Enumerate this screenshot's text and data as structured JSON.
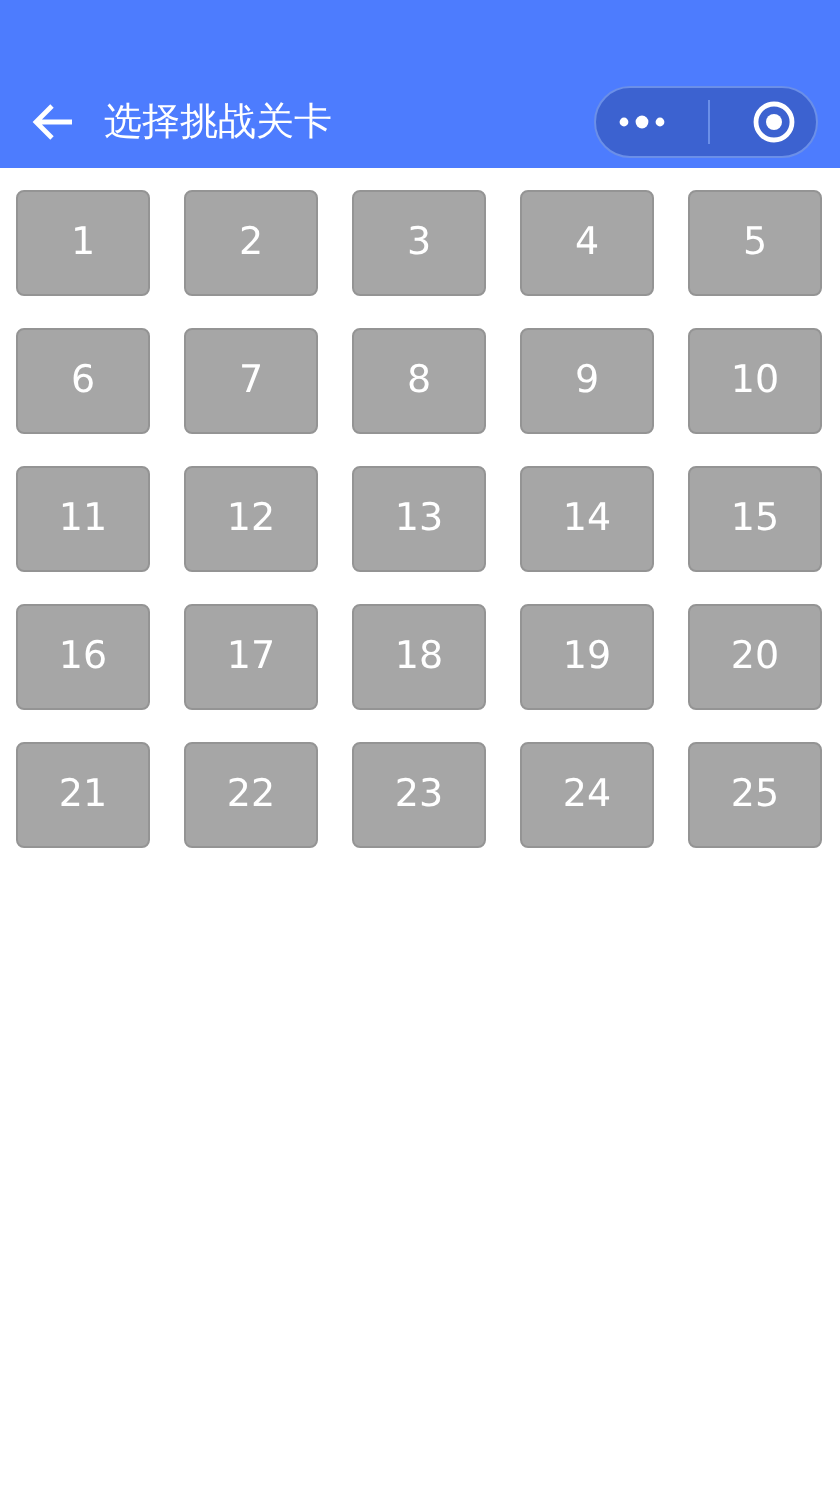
{
  "header": {
    "title": "选择挑战关卡"
  },
  "levels": [
    "1",
    "2",
    "3",
    "4",
    "5",
    "6",
    "7",
    "8",
    "9",
    "10",
    "11",
    "12",
    "13",
    "14",
    "15",
    "16",
    "17",
    "18",
    "19",
    "20",
    "21",
    "22",
    "23",
    "24",
    "25"
  ]
}
